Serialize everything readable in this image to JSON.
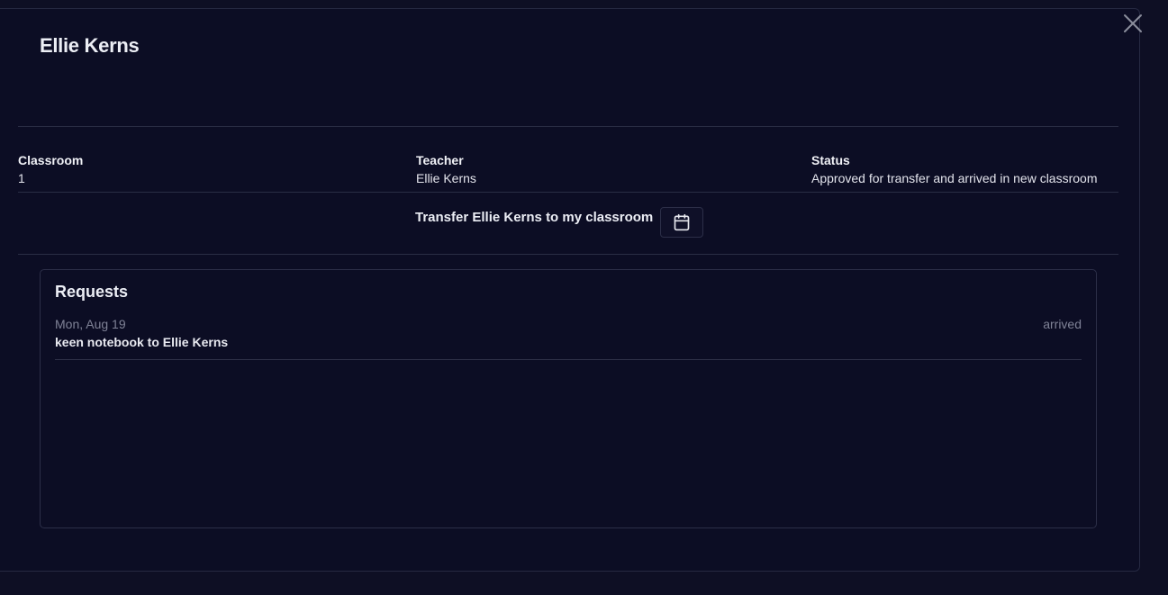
{
  "modal": {
    "title": "Ellie Kerns",
    "close_icon": "close-icon"
  },
  "info": {
    "classroom_label": "Classroom",
    "classroom_value": "1",
    "teacher_label": "Teacher",
    "teacher_value": "Ellie Kerns",
    "status_label": "Status",
    "status_value": "Approved for transfer and arrived in new classroom"
  },
  "transfer": {
    "label": "Transfer Ellie Kerns to my classroom",
    "button_icon": "calendar-icon"
  },
  "requests": {
    "title": "Requests",
    "items": [
      {
        "date": "Mon, Aug 19",
        "description": "keen notebook to Ellie Kerns",
        "status": "arrived"
      }
    ]
  },
  "colors": {
    "background": "#0c0d24",
    "border": "#2c2f48",
    "text": "#eceef5",
    "muted": "#7f8296"
  }
}
